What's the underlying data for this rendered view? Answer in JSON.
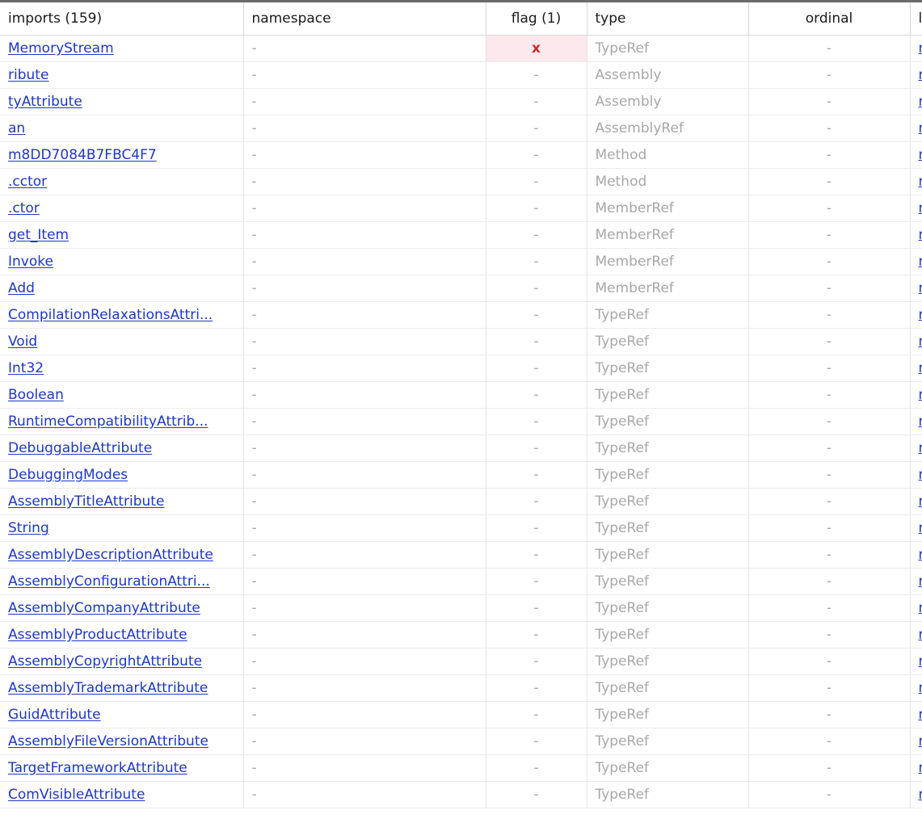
{
  "headers": {
    "imports": "imports (159)",
    "namespace": "namespace",
    "flag": "flag (1)",
    "type": "type",
    "ordinal": "ordinal",
    "library": "l"
  },
  "rows": [
    {
      "name": "MemoryStream",
      "namespace": "-",
      "flag": "x",
      "type": "TypeRef",
      "ordinal": "-",
      "library": "n"
    },
    {
      "name": "ribute",
      "namespace": "-",
      "flag": "-",
      "type": "Assembly",
      "ordinal": "-",
      "library": "n"
    },
    {
      "name": "tyAttribute",
      "namespace": "-",
      "flag": "-",
      "type": "Assembly",
      "ordinal": "-",
      "library": "n"
    },
    {
      "name": "an",
      "namespace": "-",
      "flag": "-",
      "type": "AssemblyRef",
      "ordinal": "-",
      "library": "n"
    },
    {
      "name": "m8DD7084B7FBC4F7",
      "namespace": "-",
      "flag": "-",
      "type": "Method",
      "ordinal": "-",
      "library": "n"
    },
    {
      "name": ".cctor",
      "namespace": "-",
      "flag": "-",
      "type": "Method",
      "ordinal": "-",
      "library": "n"
    },
    {
      "name": ".ctor",
      "namespace": "-",
      "flag": "-",
      "type": "MemberRef",
      "ordinal": "-",
      "library": "n"
    },
    {
      "name": "get_Item",
      "namespace": "-",
      "flag": "-",
      "type": "MemberRef",
      "ordinal": "-",
      "library": "n"
    },
    {
      "name": "Invoke",
      "namespace": "-",
      "flag": "-",
      "type": "MemberRef",
      "ordinal": "-",
      "library": "n"
    },
    {
      "name": "Add",
      "namespace": "-",
      "flag": "-",
      "type": "MemberRef",
      "ordinal": "-",
      "library": "n"
    },
    {
      "name": "CompilationRelaxationsAttri...",
      "namespace": "-",
      "flag": "-",
      "type": "TypeRef",
      "ordinal": "-",
      "library": "n"
    },
    {
      "name": "Void",
      "namespace": "-",
      "flag": "-",
      "type": "TypeRef",
      "ordinal": "-",
      "library": "n"
    },
    {
      "name": "Int32",
      "namespace": "-",
      "flag": "-",
      "type": "TypeRef",
      "ordinal": "-",
      "library": "n"
    },
    {
      "name": "Boolean",
      "namespace": "-",
      "flag": "-",
      "type": "TypeRef",
      "ordinal": "-",
      "library": "n"
    },
    {
      "name": "RuntimeCompatibilityAttrib...",
      "namespace": "-",
      "flag": "-",
      "type": "TypeRef",
      "ordinal": "-",
      "library": "n"
    },
    {
      "name": "DebuggableAttribute",
      "namespace": "-",
      "flag": "-",
      "type": "TypeRef",
      "ordinal": "-",
      "library": "n"
    },
    {
      "name": "DebuggingModes",
      "namespace": "-",
      "flag": "-",
      "type": "TypeRef",
      "ordinal": "-",
      "library": "n"
    },
    {
      "name": "AssemblyTitleAttribute",
      "namespace": "-",
      "flag": "-",
      "type": "TypeRef",
      "ordinal": "-",
      "library": "n"
    },
    {
      "name": "String",
      "namespace": "-",
      "flag": "-",
      "type": "TypeRef",
      "ordinal": "-",
      "library": "n"
    },
    {
      "name": "AssemblyDescriptionAttribute",
      "namespace": "-",
      "flag": "-",
      "type": "TypeRef",
      "ordinal": "-",
      "library": "n"
    },
    {
      "name": "AssemblyConfigurationAttri...",
      "namespace": "-",
      "flag": "-",
      "type": "TypeRef",
      "ordinal": "-",
      "library": "n"
    },
    {
      "name": "AssemblyCompanyAttribute",
      "namespace": "-",
      "flag": "-",
      "type": "TypeRef",
      "ordinal": "-",
      "library": "n"
    },
    {
      "name": "AssemblyProductAttribute",
      "namespace": "-",
      "flag": "-",
      "type": "TypeRef",
      "ordinal": "-",
      "library": "n"
    },
    {
      "name": "AssemblyCopyrightAttribute",
      "namespace": "-",
      "flag": "-",
      "type": "TypeRef",
      "ordinal": "-",
      "library": "n"
    },
    {
      "name": "AssemblyTrademarkAttribute",
      "namespace": "-",
      "flag": "-",
      "type": "TypeRef",
      "ordinal": "-",
      "library": "n"
    },
    {
      "name": "GuidAttribute",
      "namespace": "-",
      "flag": "-",
      "type": "TypeRef",
      "ordinal": "-",
      "library": "n"
    },
    {
      "name": "AssemblyFileVersionAttribute",
      "namespace": "-",
      "flag": "-",
      "type": "TypeRef",
      "ordinal": "-",
      "library": "n"
    },
    {
      "name": "TargetFrameworkAttribute",
      "namespace": "-",
      "flag": "-",
      "type": "TypeRef",
      "ordinal": "-",
      "library": "n"
    },
    {
      "name": "ComVisibleAttribute",
      "namespace": "-",
      "flag": "-",
      "type": "TypeRef",
      "ordinal": "-",
      "library": "n"
    }
  ],
  "colors": {
    "link": "#1f36c9",
    "flag_highlight_bg": "#fde8ed",
    "flag_highlight_text": "#c62828",
    "muted_text": "#a8a8a8"
  }
}
